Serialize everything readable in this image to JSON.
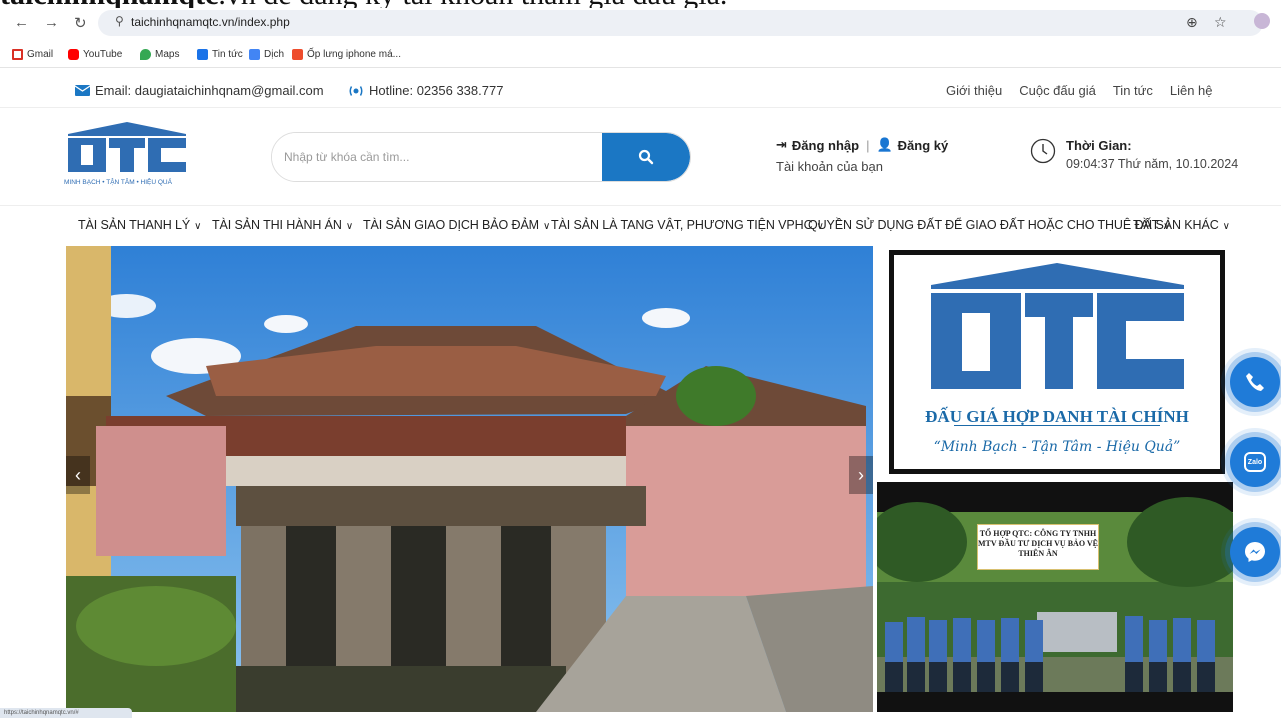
{
  "caption": {
    "bold": "taichinhqnamqtc",
    "rest": ".vn để đăng ký tài khoản tham gia đấu giá."
  },
  "browser": {
    "url": "taichinhqnamqtc.vn/index.php",
    "bookmarks": [
      "Gmail",
      "YouTube",
      "Maps",
      "Tin tức",
      "Dịch",
      "Ốp lưng iphone má..."
    ]
  },
  "topbar": {
    "email": "Email: daugiataichinhqnam@gmail.com",
    "hotline": "Hotline: 02356 338.777",
    "links": [
      "Giới thiệu",
      "Cuộc đấu giá",
      "Tin tức",
      "Liên hệ"
    ]
  },
  "header": {
    "logo_tagline": "MINH BẠCH • TẬN TÂM • HIỆU QUẢ",
    "search_placeholder": "Nhập từ khóa cần tìm...",
    "login": "Đăng nhập",
    "separator": "|",
    "register": "Đăng ký",
    "account_label": "Tài khoản của bạn",
    "time_label": "Thời Gian:",
    "time_value": "09:04:37 Thứ năm, 10.10.2024"
  },
  "nav": [
    "TÀI SẢN THANH LÝ",
    "TÀI SẢN THI HÀNH ÁN",
    "TÀI SẢN GIAO DỊCH BẢO ĐẢM",
    "TÀI SẢN LÀ TANG VẬT, PHƯƠNG TIỆN VPHC",
    "QUYỀN SỬ DỤNG ĐẤT ĐỂ GIAO ĐẤT HOẶC CHO THUÊ ĐẤT",
    "TÀI SẢN KHÁC"
  ],
  "sidebar": {
    "logo_title": "ĐẤU GIÁ HỢP DANH TÀI CHÍNH",
    "logo_slogan": "“Minh Bạch - Tận Tâm - Hiệu Quả”",
    "banner_text": "TỔ HỢP QTC: CÔNG TY TNHH MTV ĐẦU TƯ DỊCH VỤ BẢO VỆ THIÊN ÂN"
  },
  "floating": {
    "zalo": "Zalo"
  },
  "statusbar": "https://taichinhqnamqtc.vn/#",
  "colors": {
    "brand_blue": "#1b77c4",
    "logo_blue": "#2f6db3",
    "float_blue": "#1f7bd8"
  }
}
